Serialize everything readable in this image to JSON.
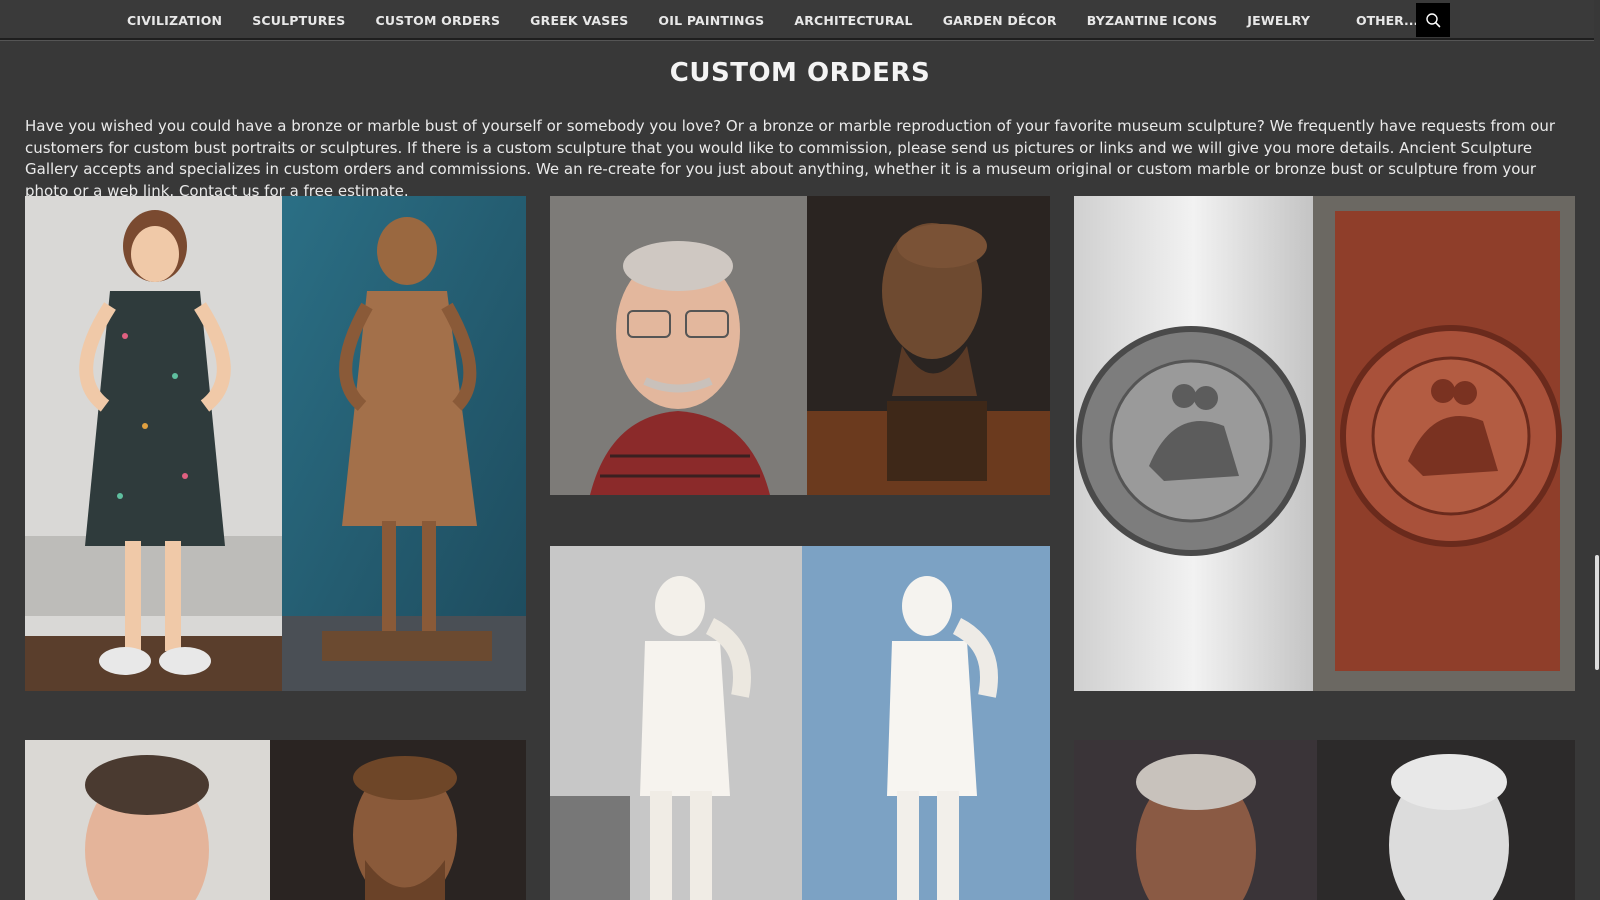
{
  "nav": {
    "items": [
      "CIVILIZATION",
      "SCULPTURES",
      "CUSTOM ORDERS",
      "GREEK VASES",
      "OIL PAINTINGS",
      "ARCHITECTURAL",
      "GARDEN DÉCOR",
      "BYZANTINE ICONS",
      "JEWELRY"
    ],
    "other_label": "OTHER...",
    "search_icon": "search-icon"
  },
  "page": {
    "title": "CUSTOM ORDERS",
    "intro": "Have you wished you could have a bronze or marble bust of yourself or somebody you love? Or a bronze or marble reproduction of your favorite museum sculpture? We frequently have requests from our customers for custom bust portraits or sculptures. If there is a custom sculpture that you would like to commission, please send us pictures or links and we will give you more details. Ancient Sculpture Gallery accepts and specializes in custom orders and commissions. We an re-create for you just about anything, whether it is a museum original or custom marble or bronze bust or sculpture from your photo or a web link. Contact us for a free estimate."
  },
  "gallery": [
    {
      "name": "girl-bronze-statue",
      "left_subject": "photo of a little girl in floral dress",
      "right_subject": "bronze statue of the girl"
    },
    {
      "name": "man-bronze-bust",
      "left_subject": "photo of an older man with glasses",
      "right_subject": "bronze bust on wooden base"
    },
    {
      "name": "templar-seal",
      "left_subject": "silver templar seal medallion",
      "right_subject": "copper relief of templar seal"
    },
    {
      "name": "marble-statue",
      "left_subject": "white marble classical statue",
      "right_subject": "marble statue on blue background"
    },
    {
      "name": "man-bronze-relief",
      "left_subject": "photo of a man smiling",
      "right_subject": "bronze bust of bearded man"
    },
    {
      "name": "man-white-bust",
      "left_subject": "photo of an older man",
      "right_subject": "white resin bust"
    }
  ],
  "colors": {
    "background": "#383838",
    "topbar": "#3a3a3a",
    "search_button": "#000000",
    "text": "#eaeaea"
  }
}
